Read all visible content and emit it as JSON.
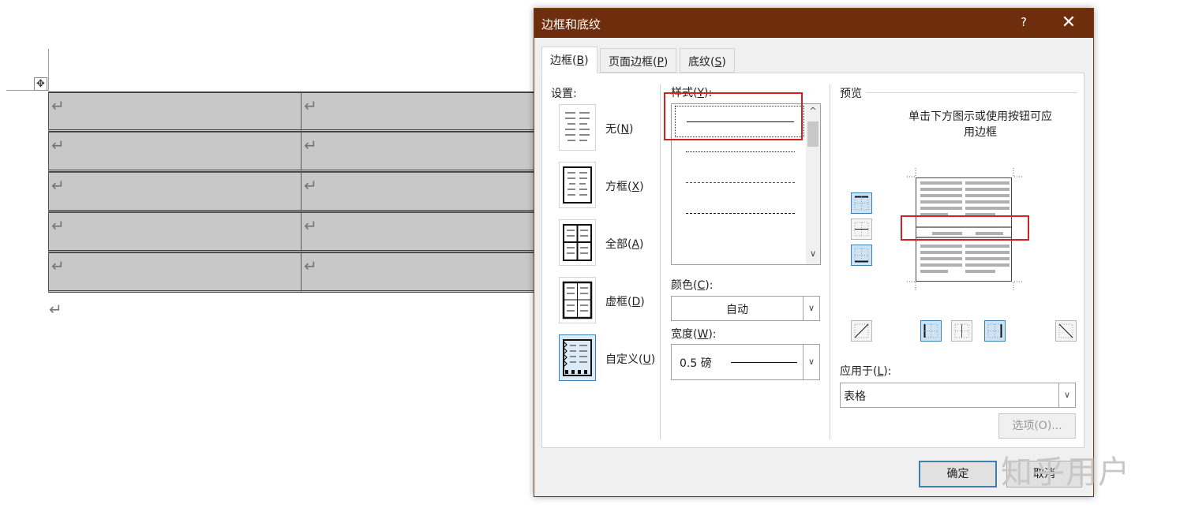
{
  "document": {
    "move_handle_icon": "move-cross-icon",
    "cell_mark": "↵",
    "paragraph_mark": "↵",
    "rows": 5,
    "cell_fill": "#c8c8c8"
  },
  "dialog": {
    "title": "边框和底纹",
    "help": "?",
    "close": "✕",
    "titlebar_color": "#6e2d0c",
    "tabs": [
      {
        "label": "边框(",
        "key": "B",
        "tail": ")",
        "active": true
      },
      {
        "label": "页面边框(",
        "key": "P",
        "tail": ")",
        "active": false
      },
      {
        "label": "底纹(",
        "key": "S",
        "tail": ")",
        "active": false
      }
    ],
    "settings": {
      "heading": "设置:",
      "items": [
        {
          "label": "无(",
          "key": "N",
          "tail": ")"
        },
        {
          "label": "方框(",
          "key": "X",
          "tail": ")"
        },
        {
          "label": "全部(",
          "key": "A",
          "tail": ")"
        },
        {
          "label": "虚框(",
          "key": "D",
          "tail": ")"
        },
        {
          "label": "自定义(",
          "key": "U",
          "tail": ")"
        }
      ],
      "selected_index": 4
    },
    "style": {
      "heading_pre": "样式(",
      "heading_key": "Y",
      "heading_tail": "):",
      "selected_index": 0,
      "scroll_up": "^",
      "scroll_down": "∨"
    },
    "color": {
      "heading_pre": "颜色(",
      "heading_key": "C",
      "heading_tail": "):",
      "value": "自动"
    },
    "width": {
      "heading_pre": "宽度(",
      "heading_key": "W",
      "heading_tail": "):",
      "value": "0.5 磅"
    },
    "preview": {
      "heading": "预览",
      "description_line1": "单击下方图示或使用按钮可应",
      "description_line2": "用边框"
    },
    "apply_to": {
      "heading_pre": "应用于(",
      "heading_key": "L",
      "heading_tail": "):",
      "value": "表格"
    },
    "options_button": "选项(O)...",
    "ok_button": "确定",
    "cancel_button": "取消"
  },
  "watermark": "知乎用户",
  "highlight_color": "#d42020"
}
